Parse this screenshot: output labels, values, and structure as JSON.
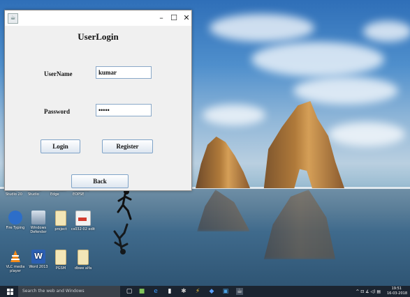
{
  "window": {
    "title": "UserLogin",
    "controls": {
      "minimize": "–",
      "maximize": "☐",
      "close": "✕"
    },
    "username_label": "UserName",
    "username_value": "kumar",
    "password_label": "Password",
    "password_value": "•••••",
    "login_label": "Login",
    "register_label": "Register",
    "back_label": "Back"
  },
  "desktop": {
    "top_row": [
      "Visual Studio 20",
      "Android Studio",
      "Microsoft Edge",
      "TOUTNAL EOPSE"
    ],
    "icons": [
      {
        "label": "Fire Typing",
        "icon": "typing-tutor-icon",
        "color": "#3a7bd5"
      },
      {
        "label": "Windows Defender",
        "icon": "shield-app-icon",
        "color": "#8aa0b8"
      },
      {
        "label": "project",
        "icon": "folder-icon",
        "color": "#f1d27a"
      },
      {
        "label": "cs032-02 edit",
        "icon": "pdf-file-icon",
        "color": "#e7e7e7"
      },
      {
        "label": "VLC media player",
        "icon": "vlc-cone-icon",
        "color": "#f28a1a"
      },
      {
        "label": "Word 2013",
        "icon": "word-icon",
        "color": "#2b5fb3"
      },
      {
        "label": "PGSM",
        "icon": "folder-icon",
        "color": "#f1d27a"
      },
      {
        "label": "dbwe alfa",
        "icon": "folder-icon",
        "color": "#f1d27a"
      }
    ]
  },
  "taskbar": {
    "search_placeholder": "Search the web and Windows",
    "time": "19:51",
    "date": "16-03-2018",
    "tray_icons": "^ ⊡ ∡ ◁) ▤"
  }
}
